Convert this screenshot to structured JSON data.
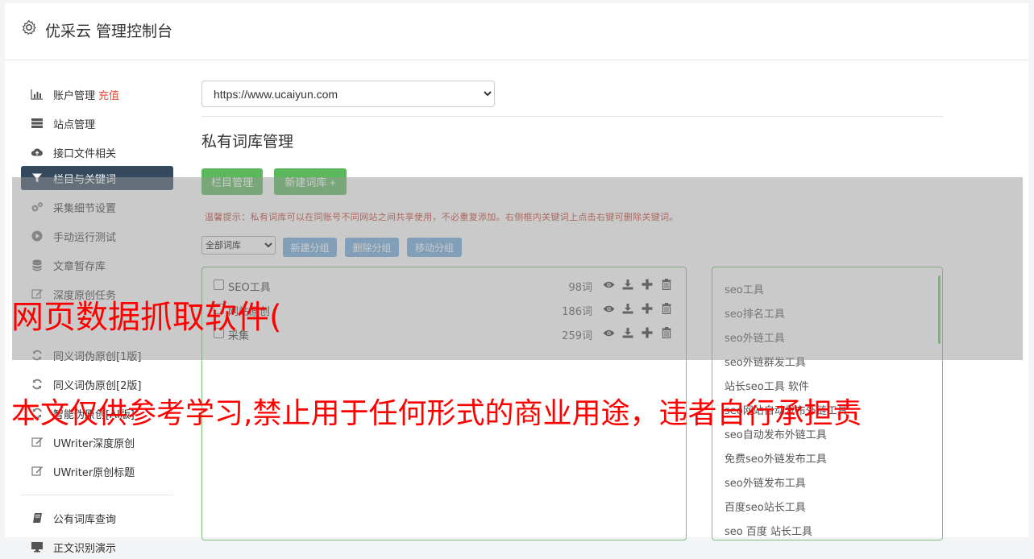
{
  "header": {
    "title": "优采云 管理控制台",
    "icon": "gear-icon"
  },
  "sidebar": {
    "items": [
      {
        "label": "账户管理",
        "badge": "充值",
        "icon": "bar-chart-icon"
      },
      {
        "label": "站点管理",
        "icon": "server-icon"
      },
      {
        "label": "接口文件相关",
        "icon": "cloud-upload-icon"
      },
      {
        "label": "栏目与关键词",
        "icon": "filter-icon",
        "active": true
      },
      {
        "label": "采集细节设置",
        "icon": "cogs-icon"
      },
      {
        "label": "手动运行测试",
        "icon": "play-circle-icon"
      },
      {
        "label": "文章暂存库",
        "icon": "database-icon"
      },
      {
        "label": "深度原创任务",
        "icon": "edit-icon"
      },
      {
        "label": "同义词伪原创[1版]",
        "icon": "refresh-icon"
      },
      {
        "label": "同义词伪原创[2版]",
        "icon": "refresh-icon"
      },
      {
        "label": "智能伪原创[AI版]",
        "icon": "refresh-icon"
      },
      {
        "label": "UWriter深度原创",
        "icon": "edit-icon"
      },
      {
        "label": "UWriter原创标题",
        "icon": "edit-icon"
      }
    ],
    "items2": [
      {
        "label": "公有词库查询",
        "icon": "book-icon"
      },
      {
        "label": "正文识别演示",
        "icon": "desktop-icon"
      }
    ]
  },
  "content": {
    "site_select_value": "https://www.ucaiyun.com",
    "page_title": "私有词库管理",
    "btn_columns": "栏目管理",
    "btn_new_lib": "新建词库 +",
    "tip": "温馨提示：私有词库可以在同账号不同网站之间共享使用，不必重复添加。右侧框内关键词上点击右键可删除关键词。",
    "group_select_value": "全部词库",
    "btn_new_group": "新建分组",
    "btn_del_group": "删除分组",
    "btn_move_group": "移动分组",
    "libraries": [
      {
        "name": "SEO工具",
        "count": "98词"
      },
      {
        "name": "网站原创",
        "count": "186词"
      },
      {
        "name": "采集",
        "count": "259词"
      }
    ],
    "keywords": [
      "seo工具",
      "seo排名工具",
      "seo外链工具",
      "seo外链群发工具",
      "站长seo工具 软件",
      "seo网站自动发布外链工具",
      "seo自动发布外链工具",
      "免费seo外链发布工具",
      "seo外链发布工具",
      "百度seo站长工具",
      "seo 百度 站长工具"
    ]
  },
  "watermark": {
    "line1": "网页数据抓取软件(",
    "line2": "本文仅供参考学习,禁止用于任何形式的商业用途，违者自行承担责"
  }
}
